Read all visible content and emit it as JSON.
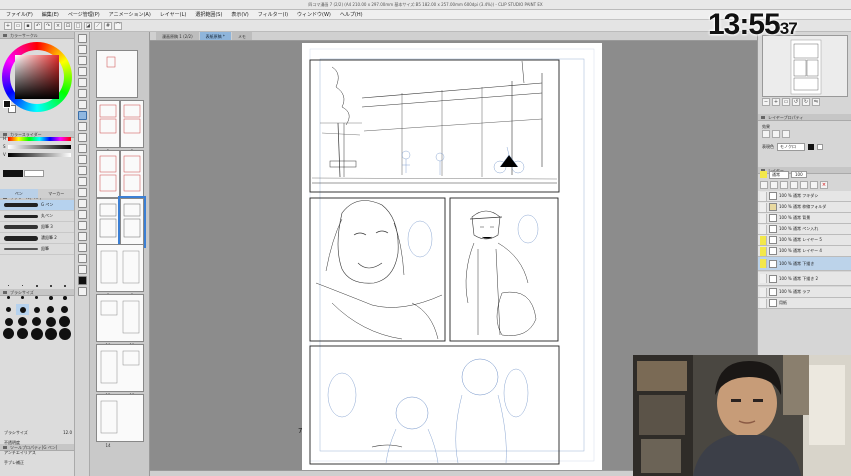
{
  "app": {
    "title": "四コマ漫画 7 (2/2) (A4 210.00 x 297.00mm 基本サイズ:B5 182.00 x 257.00mm 600dpi (3.4%)) - CLIP STUDIO PAINT EX"
  },
  "menu": [
    "ファイル(F)",
    "編集(E)",
    "ページ管理(P)",
    "アニメーション(A)",
    "レイヤー(L)",
    "選択範囲(S)",
    "表示(V)",
    "フィルター(I)",
    "ウィンドウ(W)",
    "ヘルプ(H)"
  ],
  "clock": {
    "hm": "13:55",
    "sec": "37"
  },
  "left_panel": {
    "color_wheel_title": "カラーサークル",
    "color_slider_title": "カラースライダー",
    "subtool_title": "サブツール[ペン]",
    "subtool_tabs": [
      "ペン",
      "マーカー"
    ],
    "brushes": [
      "G ペン",
      "丸ペン",
      "鉛筆 3",
      "濃鉛筆 2",
      "鉛筆"
    ],
    "brush_size_title": "ブラシサイズ",
    "brush_sizes": [
      "0.7",
      "1",
      "1.5",
      "2",
      "2.5",
      "3",
      "4",
      "5",
      "6",
      "7",
      "8",
      "10",
      "12",
      "15",
      "17",
      "20",
      "25",
      "30",
      "40",
      "50"
    ],
    "tool_property_title": "ツールプロパティ[G ペン]",
    "properties": [
      "ブラシサイズ",
      "不透明度",
      "アンチエイリアス",
      "手ブレ補正"
    ],
    "size_value": "12.0"
  },
  "page_manager": {
    "pages": [
      "1",
      "2",
      "3",
      "4",
      "5",
      "6",
      "7",
      "8",
      "9",
      "10",
      "11",
      "12",
      "13",
      "14"
    ],
    "selected_page": "7"
  },
  "canvas": {
    "tabs": [
      "漫画原稿 1 (2/2)",
      "表紙原稿 *",
      "メモ"
    ],
    "page_number": "7"
  },
  "right_panel": {
    "property_title": "レイヤープロパティ",
    "layer_title": "レイヤー",
    "effect_label": "効果",
    "expression_color_label": "表現色",
    "expression_color_value": "モノクロ",
    "blend_mode": "通常",
    "opacity": "100",
    "layers": [
      {
        "name": "100 % 通常 フキダシ",
        "yellow": false,
        "selected": false
      },
      {
        "name": "100 % 通常 枠線フォルダ",
        "yellow": false,
        "selected": false
      },
      {
        "name": "100 % 通常 背景",
        "yellow": false,
        "selected": false
      },
      {
        "name": "100 % 通常 ペン入れ",
        "yellow": false,
        "selected": false
      },
      {
        "name": "100 % 通常 レイヤー 5",
        "yellow": true,
        "selected": false
      },
      {
        "name": "100 % 通常 レイヤー 4",
        "yellow": true,
        "selected": false
      },
      {
        "name": "100 % 通常 下描き",
        "yellow": true,
        "selected": true
      },
      {
        "name": "100 % 通常 下描き 2",
        "yellow": false,
        "selected": false
      },
      {
        "name": "100 % 通常 ラフ",
        "yellow": false,
        "selected": false
      },
      {
        "name": "用紙",
        "yellow": false,
        "selected": false
      }
    ]
  }
}
